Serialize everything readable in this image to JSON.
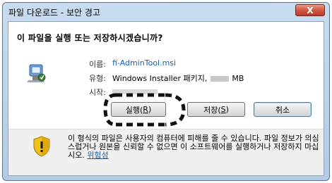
{
  "window": {
    "title": "파일 다운로드 - 보안 경고",
    "close_label": "X"
  },
  "dialog": {
    "question": "이 파일을 실행 또는 저장하시겠습니까?",
    "fields": {
      "name_label": "이름:",
      "name_value": "fi-AdminTool.msi",
      "type_label": "유형:",
      "type_value_prefix": "Windows Installer 패키지,",
      "type_value_suffix": "MB",
      "from_label": "시작:"
    },
    "buttons": {
      "run_main": "실행(",
      "run_key": "R",
      "run_end": ")",
      "save_main": "저장(",
      "save_key": "S",
      "save_end": ")",
      "cancel": "취소"
    },
    "warning": {
      "text": "이 형식의 파일은 사용자의 컴퓨터에 피해를 줄 수 있습니다. 파일 정보가 의심스럽거나 원본을 신뢰할 수 없으면 이 소프트웨어를 실행하거나 저장하지 마십시오.",
      "link": "위험성"
    }
  },
  "colors": {
    "link": "#1b5fb0",
    "title_bar": "#c9dcef",
    "close_button": "#d1573f"
  },
  "icons": [
    "close-icon",
    "installer-package-icon",
    "shield-warning-icon"
  ]
}
